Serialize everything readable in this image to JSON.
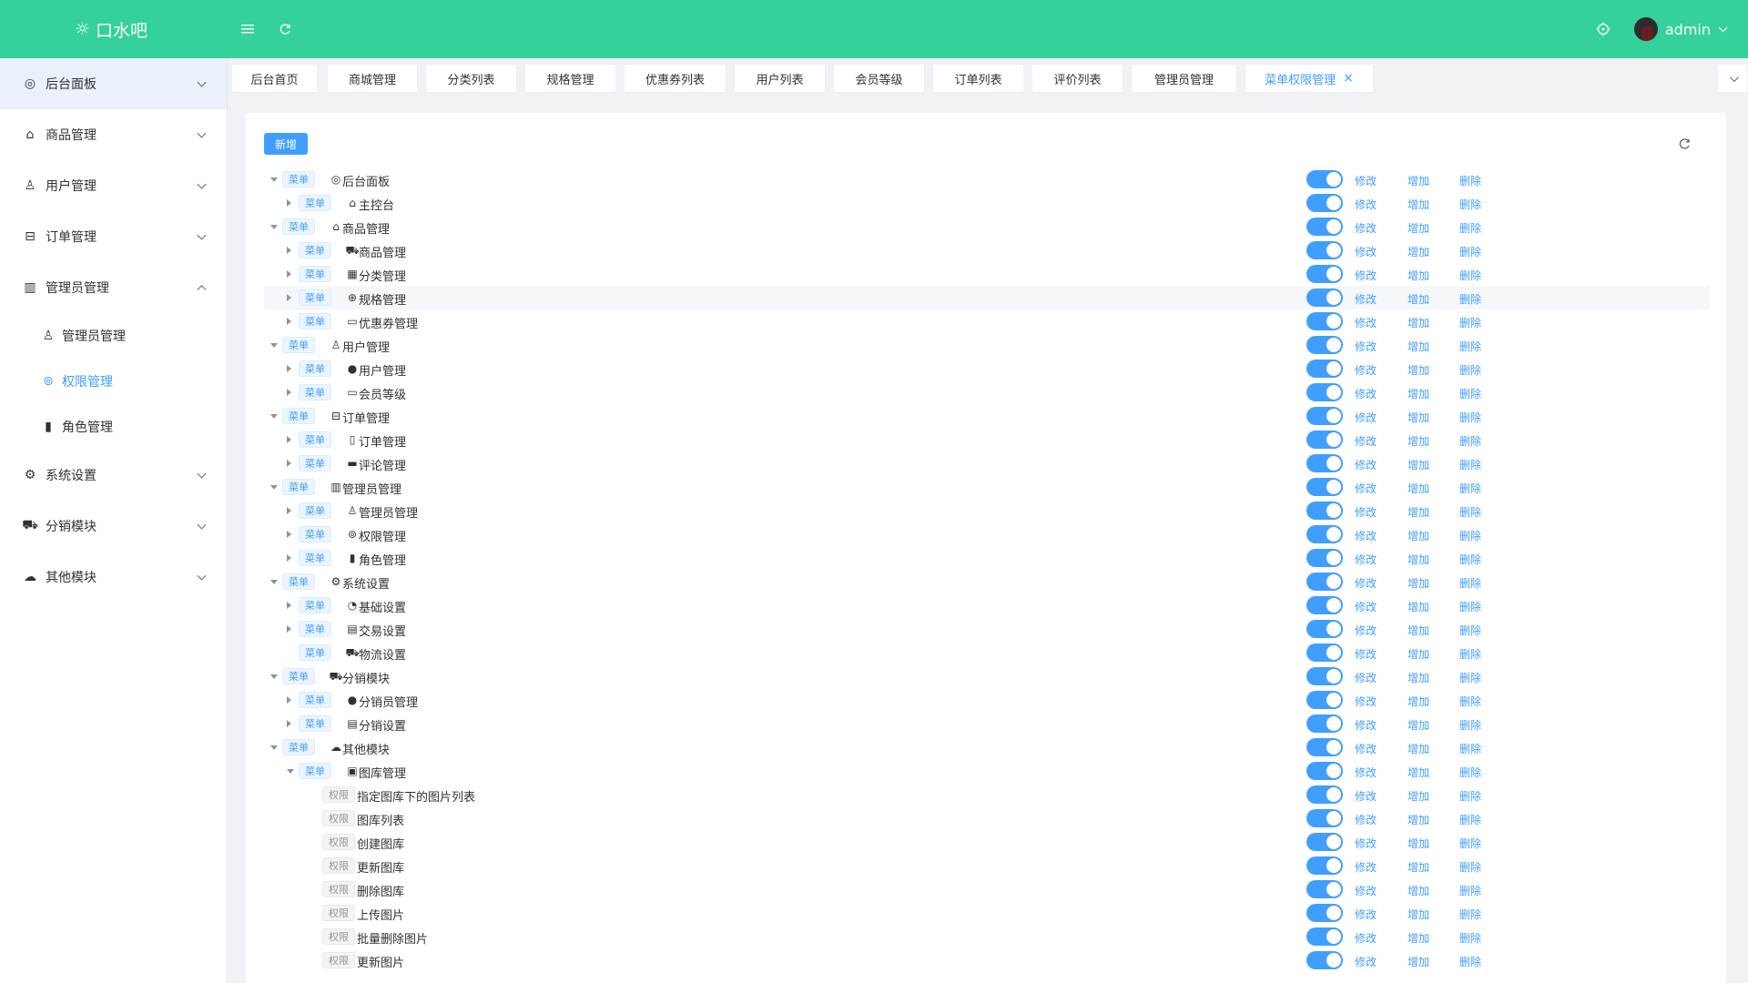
{
  "header": {
    "logo_text": "口水吧",
    "username": "admin",
    "accent": "#34d19a"
  },
  "sidebar": {
    "items": [
      {
        "label": "后台面板",
        "icon": "dashboard-icon",
        "expanded": false,
        "active": true
      },
      {
        "label": "商品管理",
        "icon": "shopping-bag-icon",
        "expanded": false
      },
      {
        "label": "用户管理",
        "icon": "user-icon",
        "expanded": false
      },
      {
        "label": "订单管理",
        "icon": "inbox-icon",
        "expanded": false
      },
      {
        "label": "管理员管理",
        "icon": "books-icon",
        "expanded": true,
        "children": [
          {
            "label": "管理员管理",
            "icon": "admin-user-icon"
          },
          {
            "label": "权限管理",
            "icon": "permission-icon",
            "active": true
          },
          {
            "label": "角色管理",
            "icon": "bar-chart-icon"
          }
        ]
      },
      {
        "label": "系统设置",
        "icon": "gear-icon",
        "expanded": false
      },
      {
        "label": "分销模块",
        "icon": "cart-icon",
        "expanded": false
      },
      {
        "label": "其他模块",
        "icon": "cloud-icon",
        "expanded": false
      }
    ]
  },
  "tabs": [
    {
      "label": "后台首页"
    },
    {
      "label": "商城管理"
    },
    {
      "label": "分类列表"
    },
    {
      "label": "规格管理"
    },
    {
      "label": "优惠券列表"
    },
    {
      "label": "用户列表"
    },
    {
      "label": "会员等级"
    },
    {
      "label": "订单列表"
    },
    {
      "label": "评价列表"
    },
    {
      "label": "管理员管理"
    },
    {
      "label": "菜单权限管理",
      "active": true,
      "closable": true
    }
  ],
  "toolbar": {
    "add_label": "新增"
  },
  "actions": {
    "edit": "修改",
    "add": "增加",
    "delete": "删除"
  },
  "tag_labels": {
    "menu": "菜单",
    "perm": "权限"
  },
  "tree": [
    {
      "level": 0,
      "type": "menu",
      "caret": "expanded",
      "icon": "dashboard-icon",
      "label": "后台面板"
    },
    {
      "level": 1,
      "type": "menu",
      "caret": "collapsed",
      "icon": "home-icon",
      "label": "主控台"
    },
    {
      "level": 0,
      "type": "menu",
      "caret": "expanded",
      "icon": "shopping-bag-icon",
      "label": "商品管理"
    },
    {
      "level": 1,
      "type": "menu",
      "caret": "collapsed",
      "icon": "cart-icon",
      "label": "商品管理"
    },
    {
      "level": 1,
      "type": "menu",
      "caret": "collapsed",
      "icon": "grid-icon",
      "label": "分类管理"
    },
    {
      "level": 1,
      "type": "menu",
      "caret": "collapsed",
      "icon": "spec-icon",
      "label": "规格管理",
      "highlight": true
    },
    {
      "level": 1,
      "type": "menu",
      "caret": "collapsed",
      "icon": "coupon-icon",
      "label": "优惠券管理"
    },
    {
      "level": 0,
      "type": "menu",
      "caret": "expanded",
      "icon": "user-icon",
      "label": "用户管理"
    },
    {
      "level": 1,
      "type": "menu",
      "caret": "collapsed",
      "icon": "user-filled-icon",
      "label": "用户管理"
    },
    {
      "level": 1,
      "type": "menu",
      "caret": "collapsed",
      "icon": "monitor-icon",
      "label": "会员等级"
    },
    {
      "level": 0,
      "type": "menu",
      "caret": "expanded",
      "icon": "inbox-icon",
      "label": "订单管理"
    },
    {
      "level": 1,
      "type": "menu",
      "caret": "collapsed",
      "icon": "book-icon",
      "label": "订单管理"
    },
    {
      "level": 1,
      "type": "menu",
      "caret": "collapsed",
      "icon": "comment-icon",
      "label": "评论管理"
    },
    {
      "level": 0,
      "type": "menu",
      "caret": "expanded",
      "icon": "books-icon",
      "label": "管理员管理"
    },
    {
      "level": 1,
      "type": "menu",
      "caret": "collapsed",
      "icon": "admin-user-icon",
      "label": "管理员管理"
    },
    {
      "level": 1,
      "type": "menu",
      "caret": "collapsed",
      "icon": "permission-icon",
      "label": "权限管理"
    },
    {
      "level": 1,
      "type": "menu",
      "caret": "collapsed",
      "icon": "bar-chart-icon",
      "label": "角色管理"
    },
    {
      "level": 0,
      "type": "menu",
      "caret": "expanded",
      "icon": "gear-icon",
      "label": "系统设置"
    },
    {
      "level": 1,
      "type": "menu",
      "caret": "collapsed",
      "icon": "compass-icon",
      "label": "基础设置"
    },
    {
      "level": 1,
      "type": "menu",
      "caret": "collapsed",
      "icon": "wallet-icon",
      "label": "交易设置"
    },
    {
      "level": 1,
      "type": "menu",
      "caret": "none",
      "icon": "truck-icon",
      "label": "物流设置"
    },
    {
      "level": 0,
      "type": "menu",
      "caret": "expanded",
      "icon": "cart-icon",
      "label": "分销模块"
    },
    {
      "level": 1,
      "type": "menu",
      "caret": "collapsed",
      "icon": "user-filled-icon",
      "label": "分销员管理"
    },
    {
      "level": 1,
      "type": "menu",
      "caret": "collapsed",
      "icon": "document-icon",
      "label": "分销设置"
    },
    {
      "level": 0,
      "type": "menu",
      "caret": "expanded",
      "icon": "cloud-icon",
      "label": "其他模块"
    },
    {
      "level": 1,
      "type": "menu",
      "caret": "expanded",
      "icon": "picture-icon",
      "label": "图库管理"
    },
    {
      "level": 2,
      "type": "perm",
      "caret": "none",
      "label": "指定图库下的图片列表"
    },
    {
      "level": 2,
      "type": "perm",
      "caret": "none",
      "label": "图库列表"
    },
    {
      "level": 2,
      "type": "perm",
      "caret": "none",
      "label": "创建图库"
    },
    {
      "level": 2,
      "type": "perm",
      "caret": "none",
      "label": "更新图库"
    },
    {
      "level": 2,
      "type": "perm",
      "caret": "none",
      "label": "删除图库"
    },
    {
      "level": 2,
      "type": "perm",
      "caret": "none",
      "label": "上传图片"
    },
    {
      "level": 2,
      "type": "perm",
      "caret": "none",
      "label": "批量删除图片"
    },
    {
      "level": 2,
      "type": "perm",
      "caret": "none",
      "label": "更新图片"
    }
  ]
}
